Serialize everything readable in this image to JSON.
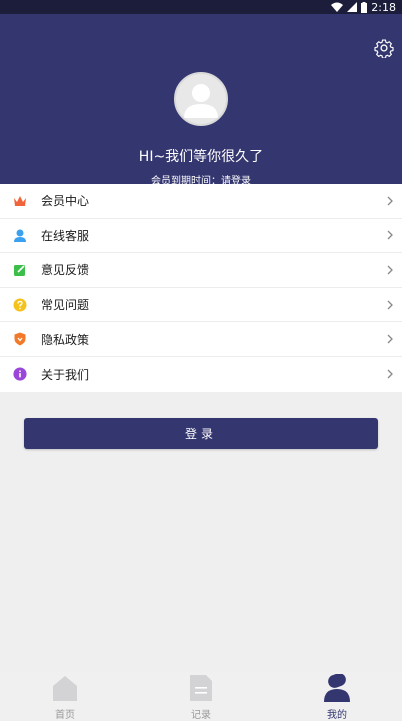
{
  "status_bar": {
    "time": "2:18"
  },
  "header": {
    "greeting": "HI~我们等你很久了",
    "member_expiry": "会员到期时间：请登录",
    "bg_color": "#343670"
  },
  "menu": {
    "items": [
      {
        "label": "会员中心",
        "icon": "crown-icon"
      },
      {
        "label": "在线客服",
        "icon": "customer-service-icon"
      },
      {
        "label": "意见反馈",
        "icon": "feedback-icon"
      },
      {
        "label": "常见问题",
        "icon": "question-icon"
      },
      {
        "label": "隐私政策",
        "icon": "shield-icon"
      },
      {
        "label": "关于我们",
        "icon": "info-icon"
      }
    ]
  },
  "login_button": {
    "label": "登录"
  },
  "tabbar": {
    "tabs": [
      {
        "label": "首页",
        "icon": "home-icon",
        "active": false
      },
      {
        "label": "记录",
        "icon": "document-icon",
        "active": false
      },
      {
        "label": "我的",
        "icon": "profile-icon",
        "active": true
      }
    ]
  }
}
